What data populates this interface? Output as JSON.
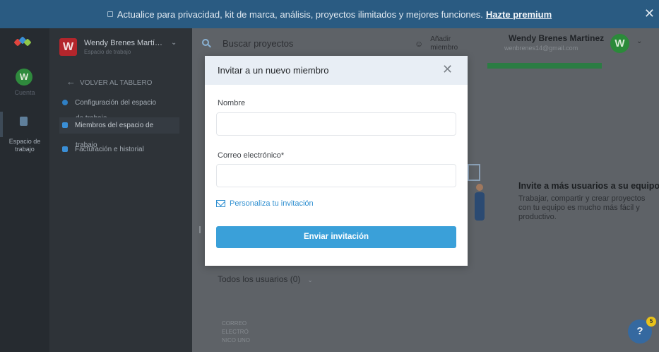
{
  "banner": {
    "text": "Actualice para privacidad, kit de marca, análisis, proyectos ilimitados y mejores funciones.",
    "link": "Hazte premium",
    "close": "✕"
  },
  "rail": {
    "account_initial": "W",
    "account_label": "Cuenta",
    "workspace_label": "Espacio de trabajo"
  },
  "workspace": {
    "initial": "W",
    "name": "Wendy Brenes Martí…",
    "subtitle": "Espacio de trabajo",
    "back_label": "VOLVER AL TABLERO",
    "menu": [
      {
        "label": "Configuración del espacio",
        "overflow": "de trabajo"
      },
      {
        "label": "Miembros del espacio de",
        "overflow": "trabajo"
      },
      {
        "label": "Facturación e historial"
      }
    ]
  },
  "header": {
    "search_placeholder": "Buscar proyectos",
    "add_member_line1": "Añadir",
    "add_member_line2": "miembro",
    "user_name": "Wendy Brenes Martinez",
    "user_email": "wenbrenes14@gmail.com",
    "user_initial": "W"
  },
  "main": {
    "invite_title": "Invite a más usuarios a su equipo",
    "invite_desc": "Trabajar, compartir y crear proyectos con tu equipo es mucho más fácil y productivo.",
    "all_users": "Todos los usuarios (0)",
    "column_header": [
      "CORREO",
      "ELECTRÓ",
      "NICO UNO"
    ],
    "help_label": "?",
    "help_badge": "5"
  },
  "modal": {
    "title": "Invitar a un nuevo miembro",
    "name_label": "Nombre",
    "name_value": "",
    "email_label": "Correo electrónico*",
    "email_value": "",
    "personalize": "Personaliza tu invitación",
    "send": "Enviar invitación"
  },
  "colors": {
    "banner": "#2a5b82",
    "rail": "#262b30",
    "panel": "#2e3338",
    "accent": "#3aa0d9",
    "link": "#2f8fd0",
    "avatar_green": "#2b8a3a",
    "workspace_red": "#b3262c"
  }
}
